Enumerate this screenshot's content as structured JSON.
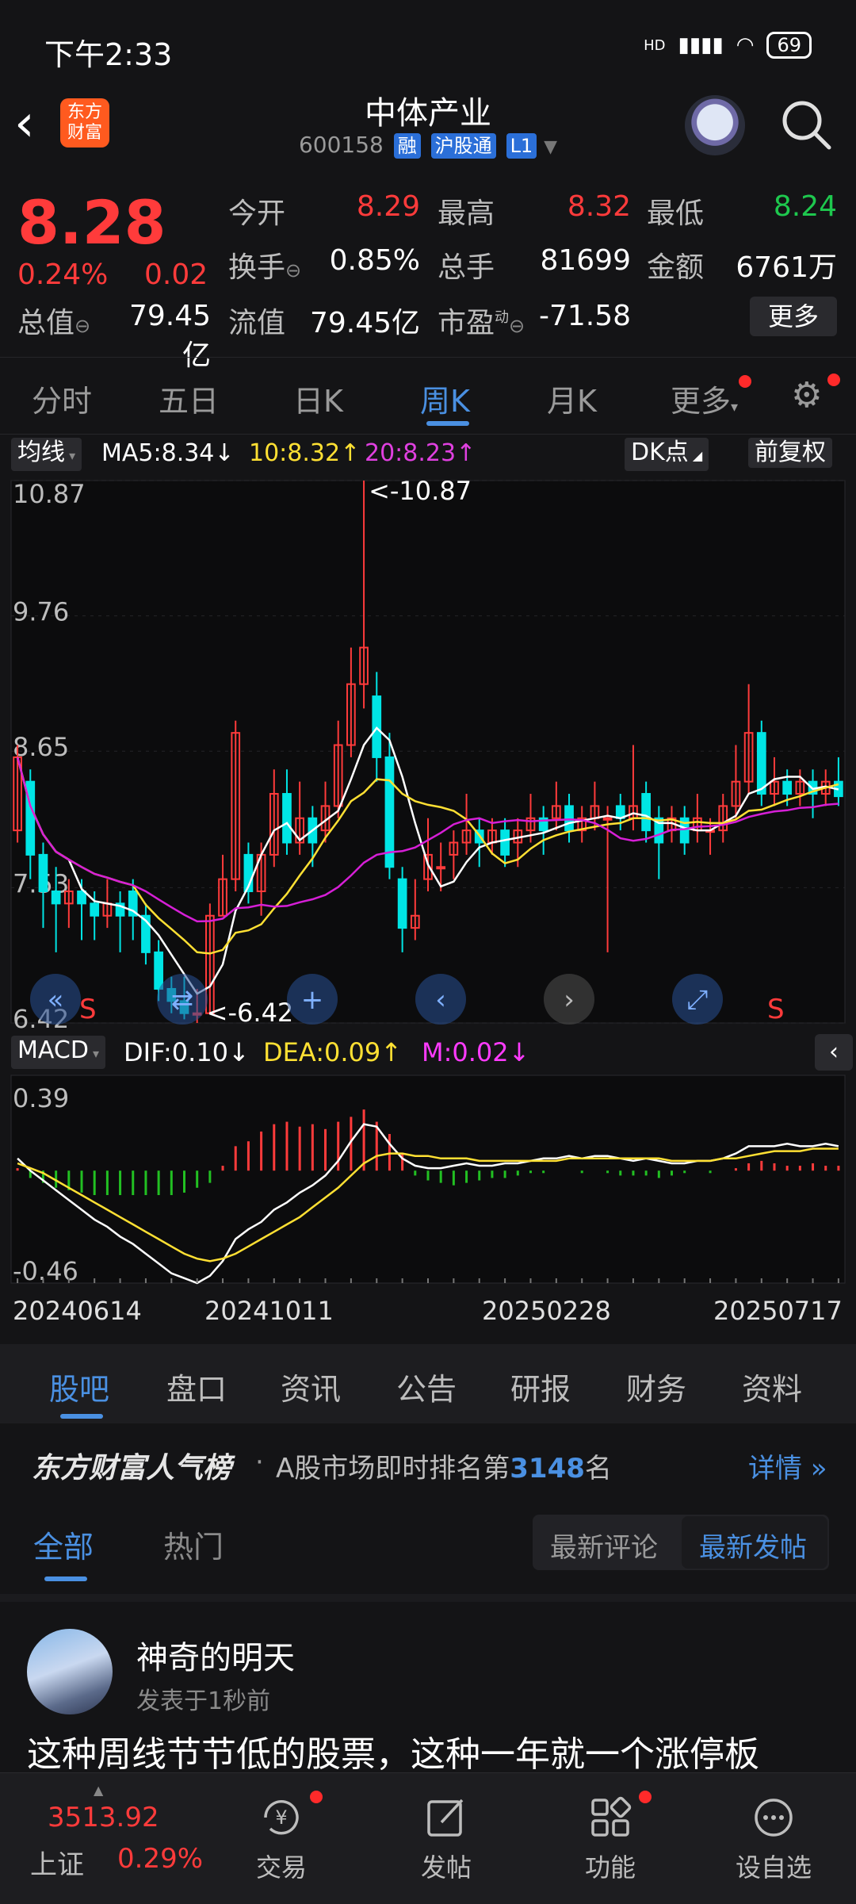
{
  "status_bar": {
    "time": "下午2:33",
    "network": "HD",
    "battery": "69"
  },
  "header": {
    "title": "中体产业",
    "code": "600158",
    "tags": [
      "融",
      "沪股通",
      "L1"
    ],
    "logo": "东方财富"
  },
  "quote": {
    "price": "8.28",
    "change_pct": "0.24%",
    "change": "0.02",
    "open_label": "今开",
    "open": "8.29",
    "high_label": "最高",
    "high": "8.32",
    "low_label": "最低",
    "low": "8.24",
    "turnover_label": "换手",
    "turnover": "0.85%",
    "volume_label": "总手",
    "volume": "81699",
    "amount_label": "金额",
    "amount": "6761万",
    "mcap_label": "总值",
    "mcap": "79.45亿",
    "float_label": "流值",
    "float": "79.45亿",
    "pe_label": "市盈",
    "pe_sup": "动",
    "pe": "-71.58",
    "more": "更多"
  },
  "chart_tabs": {
    "items": [
      "分时",
      "五日",
      "日K",
      "周K",
      "月K",
      "更多"
    ],
    "active": 3
  },
  "ma_legend": {
    "type": "均线",
    "ma5": "MA5:8.34↓",
    "ma10": "10:8.32↑",
    "ma20": "20:8.23↑",
    "dk": "DK点",
    "adjust": "前复权"
  },
  "macd_legend": {
    "type": "MACD",
    "dif": "DIF:0.10↓",
    "dea": "DEA:0.09↑",
    "m": "M:0.02↓"
  },
  "colors": {
    "up": "#ff3b3b",
    "down": "#00e5e5",
    "ma5": "#ffffff",
    "ma10": "#ffe033",
    "ma20": "#d61fd6",
    "accent": "#4a90e2",
    "dea": "#ffe033",
    "dif": "#ffffff",
    "m": "#ff3bff"
  },
  "chart_data": [
    {
      "type": "candlestick",
      "title": "",
      "y_tick_labels": [
        "10.87",
        "9.76",
        "8.65",
        "7.53",
        "6.42"
      ],
      "ylim": [
        6.42,
        10.87
      ],
      "annotations": {
        "max_label": "<-10.87",
        "min_label": "<-6.42"
      },
      "signals": [
        "S",
        "S"
      ],
      "candles": [
        [
          8.0,
          8.6,
          8.7,
          7.9
        ],
        [
          8.4,
          7.8,
          8.5,
          7.6
        ],
        [
          7.8,
          7.5,
          7.9,
          7.2
        ],
        [
          7.5,
          7.4,
          7.7,
          7.0
        ],
        [
          7.4,
          7.5,
          7.6,
          7.2
        ],
        [
          7.5,
          7.4,
          7.6,
          7.1
        ],
        [
          7.4,
          7.3,
          7.5,
          7.1
        ],
        [
          7.3,
          7.4,
          7.6,
          7.2
        ],
        [
          7.4,
          7.3,
          7.5,
          7.0
        ],
        [
          7.5,
          7.3,
          7.6,
          7.1
        ],
        [
          7.3,
          7.0,
          7.4,
          6.9
        ],
        [
          7.0,
          6.7,
          7.1,
          6.6
        ],
        [
          6.7,
          6.6,
          6.8,
          6.5
        ],
        [
          6.6,
          6.5,
          6.8,
          6.45
        ],
        [
          6.5,
          6.5,
          6.7,
          6.42
        ],
        [
          6.5,
          7.3,
          7.4,
          6.5
        ],
        [
          7.3,
          7.6,
          7.8,
          7.3
        ],
        [
          7.6,
          8.8,
          8.9,
          7.5
        ],
        [
          7.8,
          7.5,
          7.9,
          7.4
        ],
        [
          7.5,
          7.8,
          7.9,
          7.3
        ],
        [
          7.8,
          8.3,
          8.5,
          7.7
        ],
        [
          8.3,
          7.9,
          8.5,
          7.8
        ],
        [
          7.9,
          8.1,
          8.4,
          7.8
        ],
        [
          8.1,
          7.9,
          8.2,
          7.7
        ],
        [
          8.0,
          8.2,
          8.4,
          7.9
        ],
        [
          8.2,
          8.7,
          8.9,
          8.1
        ],
        [
          8.7,
          9.2,
          9.5,
          8.6
        ],
        [
          9.2,
          9.5,
          10.87,
          9.0
        ],
        [
          9.1,
          8.6,
          9.3,
          8.4
        ],
        [
          8.6,
          7.7,
          8.8,
          7.6
        ],
        [
          7.6,
          7.2,
          7.7,
          7.0
        ],
        [
          7.2,
          7.3,
          7.6,
          7.1
        ],
        [
          7.6,
          7.8,
          8.1,
          7.5
        ],
        [
          7.7,
          7.7,
          7.9,
          7.5
        ],
        [
          7.8,
          7.9,
          8.0,
          7.6
        ],
        [
          7.9,
          8.0,
          8.3,
          7.8
        ],
        [
          8.0,
          7.9,
          8.1,
          7.7
        ],
        [
          7.9,
          8.0,
          8.1,
          7.8
        ],
        [
          8.0,
          7.8,
          8.1,
          7.7
        ],
        [
          7.9,
          8.0,
          8.1,
          7.7
        ],
        [
          8.0,
          8.1,
          8.3,
          7.9
        ],
        [
          8.1,
          8.0,
          8.2,
          7.8
        ],
        [
          8.1,
          8.2,
          8.4,
          8.0
        ],
        [
          8.2,
          8.0,
          8.3,
          7.9
        ],
        [
          8.0,
          8.1,
          8.2,
          7.9
        ],
        [
          8.1,
          8.2,
          8.4,
          8.0
        ],
        [
          8.1,
          8.1,
          8.2,
          7.0
        ],
        [
          8.2,
          8.1,
          8.3,
          8.0
        ],
        [
          8.1,
          8.2,
          8.7,
          8.0
        ],
        [
          8.3,
          8.0,
          8.4,
          7.9
        ],
        [
          8.1,
          7.9,
          8.2,
          7.6
        ],
        [
          8.0,
          8.1,
          8.2,
          7.9
        ],
        [
          8.1,
          7.9,
          8.2,
          7.8
        ],
        [
          8.0,
          8.1,
          8.3,
          7.9
        ],
        [
          8.0,
          8.0,
          8.1,
          7.8
        ],
        [
          8.0,
          8.2,
          8.3,
          7.9
        ],
        [
          8.2,
          8.4,
          8.7,
          8.1
        ],
        [
          8.4,
          8.8,
          9.2,
          8.3
        ],
        [
          8.8,
          8.3,
          8.9,
          8.2
        ],
        [
          8.3,
          8.4,
          8.6,
          8.2
        ],
        [
          8.4,
          8.3,
          8.5,
          8.2
        ],
        [
          8.3,
          8.4,
          8.5,
          8.2
        ],
        [
          8.4,
          8.3,
          8.5,
          8.1
        ],
        [
          8.3,
          8.4,
          8.5,
          8.2
        ],
        [
          8.4,
          8.28,
          8.6,
          8.2
        ]
      ]
    },
    {
      "type": "macd",
      "title": "",
      "y_tick_labels": [
        "0.39",
        "-0.46"
      ],
      "ylim": [
        -0.46,
        0.39
      ],
      "x_tick_labels": [
        "20240614",
        "20241011",
        "20250228",
        "20250717"
      ],
      "hist": [
        0.01,
        -0.03,
        -0.05,
        -0.07,
        -0.08,
        -0.09,
        -0.1,
        -0.1,
        -0.1,
        -0.1,
        -0.1,
        -0.1,
        -0.1,
        -0.09,
        -0.07,
        -0.05,
        0.02,
        0.1,
        0.12,
        0.16,
        0.19,
        0.2,
        0.18,
        0.19,
        0.17,
        0.2,
        0.22,
        0.25,
        0.2,
        0.15,
        0.07,
        -0.02,
        -0.04,
        -0.05,
        -0.06,
        -0.05,
        -0.04,
        -0.03,
        -0.03,
        -0.02,
        -0.01,
        -0.01,
        0.0,
        0.0,
        -0.01,
        0.0,
        -0.01,
        -0.02,
        -0.02,
        -0.02,
        -0.03,
        -0.02,
        -0.01,
        0.0,
        -0.01,
        0.0,
        0.01,
        0.03,
        0.04,
        0.03,
        0.02,
        0.02,
        0.03,
        0.02,
        0.02
      ],
      "dif": [
        0.05,
        0.0,
        -0.04,
        -0.08,
        -0.12,
        -0.16,
        -0.2,
        -0.23,
        -0.27,
        -0.3,
        -0.34,
        -0.38,
        -0.42,
        -0.44,
        -0.46,
        -0.43,
        -0.37,
        -0.28,
        -0.24,
        -0.21,
        -0.16,
        -0.13,
        -0.09,
        -0.06,
        -0.02,
        0.04,
        0.12,
        0.19,
        0.18,
        0.11,
        0.05,
        0.02,
        0.01,
        0.01,
        0.02,
        0.03,
        0.02,
        0.02,
        0.03,
        0.03,
        0.04,
        0.05,
        0.05,
        0.06,
        0.05,
        0.06,
        0.06,
        0.05,
        0.04,
        0.05,
        0.04,
        0.03,
        0.03,
        0.04,
        0.04,
        0.05,
        0.07,
        0.1,
        0.1,
        0.1,
        0.11,
        0.1,
        0.1,
        0.11,
        0.1
      ],
      "dea": [
        0.03,
        0.01,
        -0.01,
        -0.04,
        -0.07,
        -0.1,
        -0.13,
        -0.16,
        -0.19,
        -0.22,
        -0.25,
        -0.28,
        -0.31,
        -0.34,
        -0.36,
        -0.37,
        -0.36,
        -0.34,
        -0.31,
        -0.28,
        -0.25,
        -0.22,
        -0.19,
        -0.15,
        -0.11,
        -0.07,
        -0.02,
        0.03,
        0.06,
        0.07,
        0.07,
        0.06,
        0.06,
        0.05,
        0.05,
        0.05,
        0.04,
        0.04,
        0.04,
        0.04,
        0.04,
        0.04,
        0.04,
        0.05,
        0.05,
        0.05,
        0.05,
        0.05,
        0.05,
        0.05,
        0.05,
        0.04,
        0.04,
        0.04,
        0.04,
        0.05,
        0.05,
        0.06,
        0.07,
        0.08,
        0.08,
        0.08,
        0.09,
        0.09,
        0.09
      ]
    }
  ],
  "chart_nav": [
    "double-left",
    "up",
    "plus",
    "left",
    "right",
    "expand"
  ],
  "sub_tabs": {
    "items": [
      "股吧",
      "盘口",
      "资讯",
      "公告",
      "研报",
      "财务",
      "资料"
    ],
    "active": 0
  },
  "rank": {
    "brand": "东方财富人气榜",
    "prefix": "A股市场即时排名第",
    "rank": "3148",
    "suffix": "名",
    "detail": "详情"
  },
  "feed_tabs": {
    "all": "全部",
    "hot": "热门",
    "sort_comment": "最新评论",
    "sort_post": "最新发帖"
  },
  "post": {
    "author": "神奇的明天",
    "time": "发表于1秒前",
    "text": "这种周线节节低的股票，这种一年就一个涨停板"
  },
  "bottom_bar": {
    "index_value": "3513.92",
    "index_name": "上证",
    "index_pct": "0.29%",
    "items": [
      "交易",
      "发帖",
      "功能",
      "设自选"
    ]
  }
}
